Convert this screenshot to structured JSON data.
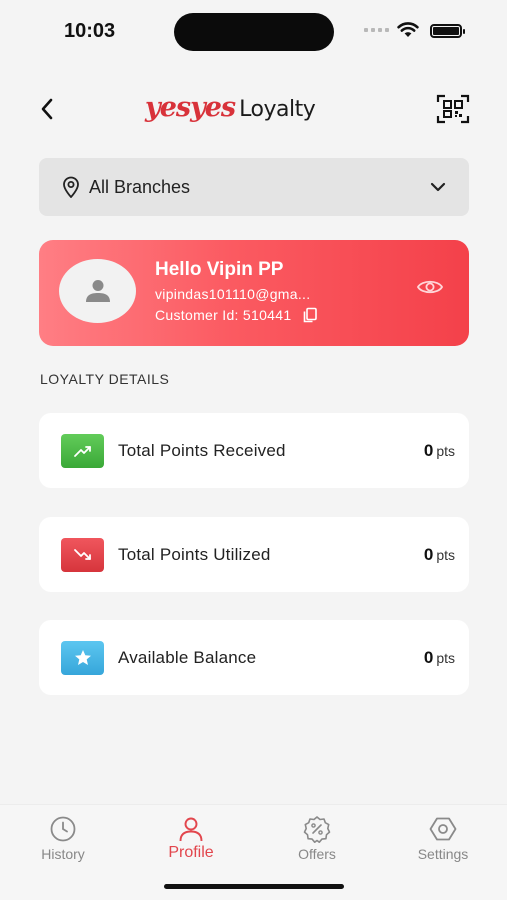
{
  "status": {
    "time": "10:03"
  },
  "header": {
    "brand_script": "yesyes",
    "brand_word": "Loyalty",
    "back_icon": "chevron-left-icon",
    "qr_icon": "qr-scan-icon"
  },
  "branch": {
    "label": "All Branches"
  },
  "profile": {
    "greeting": "Hello Vipin PP",
    "email": "vipindas101110@gma...",
    "customer_id": "Customer Id: 510441"
  },
  "loyalty": {
    "title": "LOYALTY DETAILS",
    "items": [
      {
        "label": "Total Points Received",
        "value": "0",
        "unit": "pts",
        "icon": "trending-up-icon",
        "color": "#4cbb47"
      },
      {
        "label": "Total Points Utilized",
        "value": "0",
        "unit": "pts",
        "icon": "trending-down-icon",
        "color": "#e9434a"
      },
      {
        "label": "Available Balance",
        "value": "0",
        "unit": "pts",
        "icon": "star-icon",
        "color": "#42b6e6"
      }
    ]
  },
  "nav": {
    "items": [
      {
        "label": "History",
        "icon": "clock-icon",
        "active": false
      },
      {
        "label": "Profile",
        "icon": "user-icon",
        "active": true
      },
      {
        "label": "Offers",
        "icon": "percent-badge-icon",
        "active": false
      },
      {
        "label": "Settings",
        "icon": "gear-icon",
        "active": false
      }
    ]
  },
  "colors": {
    "accent": "#e2464d",
    "card_start": "#ff7e84",
    "card_end": "#f4414a"
  }
}
